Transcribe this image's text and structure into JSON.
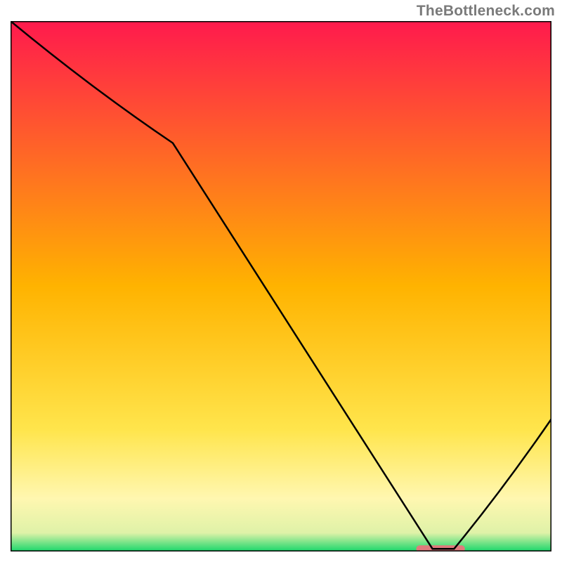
{
  "watermark": "TheBottleneck.com",
  "chart_data": {
    "type": "line",
    "title": "",
    "xlabel": "",
    "ylabel": "",
    "xlim": [
      0,
      100
    ],
    "ylim": [
      0,
      100
    ],
    "grid": false,
    "legend": false,
    "annotations": [],
    "series": [
      {
        "name": "curve",
        "x": [
          0,
          30,
          78,
          82,
          100
        ],
        "y": [
          100,
          77,
          0.5,
          0.5,
          25
        ]
      }
    ],
    "marker": {
      "name": "min-marker",
      "x_start": 75,
      "x_end": 84,
      "y": 0.5,
      "color": "#e07a7d"
    },
    "background_gradient": {
      "stops": [
        {
          "offset": 0.0,
          "color": "#ff1a4d"
        },
        {
          "offset": 0.5,
          "color": "#ffb300"
        },
        {
          "offset": 0.77,
          "color": "#ffe54c"
        },
        {
          "offset": 0.9,
          "color": "#fff7b0"
        },
        {
          "offset": 0.965,
          "color": "#dff2a8"
        },
        {
          "offset": 1.0,
          "color": "#18d66a"
        }
      ]
    },
    "frame_color": "#000000",
    "line_color": "#000000"
  }
}
